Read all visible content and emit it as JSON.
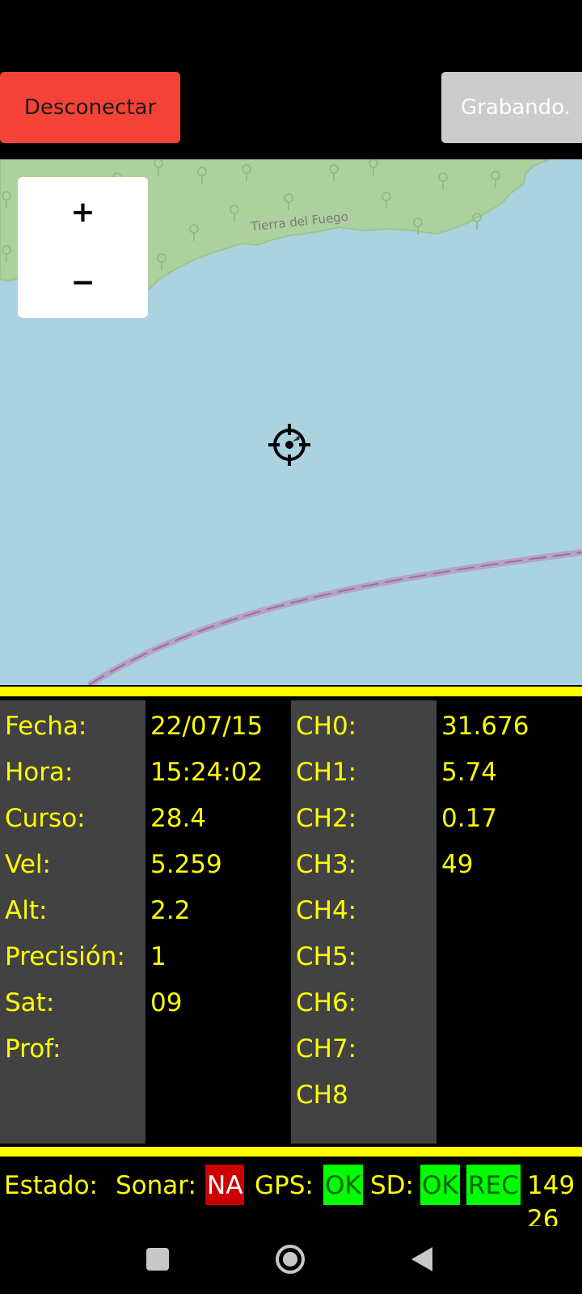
{
  "toolbar": {
    "disconnect_label": "Desconectar",
    "record_label": "Grabando."
  },
  "map": {
    "zoom_in": "+",
    "zoom_out": "−",
    "place_label": "Tierra del Fuego"
  },
  "info_labels": [
    "Fecha:",
    "Hora:",
    "Curso:",
    "Vel:",
    "Alt:",
    "Precisión:",
    "Sat:",
    "Prof:"
  ],
  "info_values": [
    "22/07/15",
    "15:24:02",
    "28.4",
    "5.259",
    "2.2",
    "1",
    "09",
    ""
  ],
  "channel_labels": [
    "CH0:",
    "CH1:",
    "CH2:",
    "CH3:",
    "CH4:",
    "CH5:",
    "CH6:",
    "CH7:",
    "CH8"
  ],
  "channel_values": [
    "31.676",
    "5.74",
    "0.17",
    "49"
  ],
  "status": {
    "estado_label": "Estado:",
    "sonar_label": "Sonar:",
    "sonar_value": "NA",
    "gps_label": "GPS:",
    "gps_value": "OK",
    "sd_label": "SD:",
    "sd_value": "OK",
    "rec_value": "REC",
    "extra_value_1": "149",
    "extra_value_2": "26"
  },
  "colors": {
    "accent_yellow": "#ffff00",
    "disconnect_red": "#f44336",
    "sea": "#aad3df",
    "land": "#add19e",
    "badge_ok": "#00ff00",
    "badge_na": "#cc0000"
  }
}
